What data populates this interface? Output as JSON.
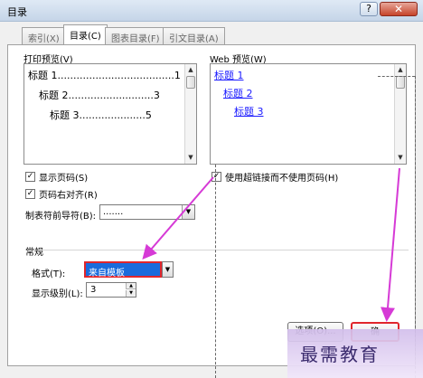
{
  "window": {
    "title": "目录",
    "help_label": "?",
    "close_label": "✕"
  },
  "tabs": [
    {
      "label": "索引(X)",
      "active": false
    },
    {
      "label": "目录(C)",
      "active": true
    },
    {
      "label": "图表目录(F)",
      "active": false
    },
    {
      "label": "引文目录(A)",
      "active": false
    }
  ],
  "print_preview": {
    "label": "打印预览(V)",
    "entries": [
      {
        "text": "标题 1.....................................1"
      },
      {
        "text": "标题 2...........................3"
      },
      {
        "text": "标题 3.....................5"
      }
    ]
  },
  "web_preview": {
    "label": "Web 预览(W)",
    "links": [
      "标题 1",
      "标题 2",
      "标题 3"
    ]
  },
  "options": {
    "show_page_numbers": {
      "label": "显示页码(S)",
      "checked": true
    },
    "right_align_page_numbers": {
      "label": "页码右对齐(R)",
      "checked": true
    },
    "use_hyperlinks": {
      "label": "使用超链接而不使用页码(H)",
      "checked": true
    },
    "tab_leader": {
      "label": "制表符前导符(B):",
      "value": "......."
    }
  },
  "general": {
    "group_label": "常规",
    "format_label": "格式(T):",
    "format_value": "来自模板",
    "show_levels_label": "显示级别(L):",
    "show_levels_value": "3"
  },
  "buttons": {
    "options_label": "选项(O)...",
    "ok_label": "确"
  },
  "watermark": {
    "text": "最需教育"
  },
  "colors": {
    "annotation_arrow": "#d63ad6",
    "highlight_border": "#e0262c",
    "selection": "#1a6bdc",
    "link": "#1a1aff"
  }
}
